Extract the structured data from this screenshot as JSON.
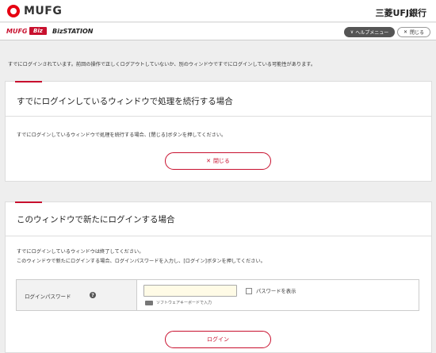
{
  "header": {
    "logo_text": "MUFG",
    "bank_name": "三菱UFJ銀行"
  },
  "subheader": {
    "brand_mufg": "MUFG",
    "brand_biz": "Biz",
    "brand_bizstation": "BizSTATION",
    "help_menu_label": "ヘルプメニュー",
    "close_label": "閉じる"
  },
  "notice": "すでにログインされています。前回の操作で正しくログアウトしていないか、別のウィンドウですでにログインしている可能性があります。",
  "section_continue": {
    "title": "すでにログインしているウィンドウで処理を続行する場合",
    "description": "すでにログインしているウィンドウで処理を続行する場合、[閉じる]ボタンを押してください。",
    "close_button": "閉じる"
  },
  "section_new_login": {
    "title": "このウィンドウで新たにログインする場合",
    "description_line1": "すでにログインしているウィンドウは終了してください。",
    "description_line2": "このウィンドウで新たにログインする場合、ログインパスワードを入力し、[ログイン]ボタンを押してください。",
    "password_label": "ログインパスワード",
    "help_icon": "?",
    "password_value": "",
    "software_keyboard": "ソフトウェアキーボードで入力",
    "show_password_label": "パスワードを表示",
    "show_password_checked": false,
    "login_button": "ログイン"
  },
  "colors": {
    "accent": "#c8102e",
    "input_bg": "#fffbe6"
  }
}
